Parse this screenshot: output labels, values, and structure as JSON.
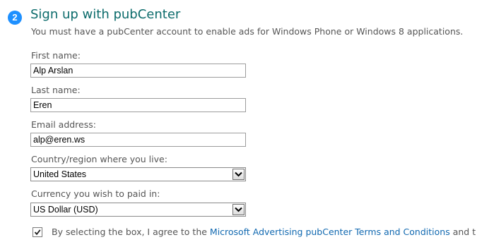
{
  "step": {
    "number": "2",
    "title": "Sign up with pubCenter",
    "subtitle": "You must have a pubCenter account to enable ads for Windows Phone or Windows 8 applications."
  },
  "form": {
    "first_name": {
      "label": "First name:",
      "value": "Alp Arslan"
    },
    "last_name": {
      "label": "Last name:",
      "value": "Eren"
    },
    "email": {
      "label": "Email address:",
      "value": "alp@eren.ws"
    },
    "country": {
      "label": "Country/region where you live:",
      "selected": "United States"
    },
    "currency": {
      "label": "Currency you wish to paid in:",
      "selected": "US Dollar (USD)"
    },
    "agreement": {
      "checked": true,
      "text_before": "By selecting the box, I agree to the ",
      "link_text": "Microsoft Advertising pubCenter Terms and Conditions",
      "text_after": " and t"
    }
  },
  "icons": {
    "dropdown": "chevron-down-icon",
    "checkbox": "checkmark-icon"
  },
  "colors": {
    "badge": "#1e90ff",
    "title": "#0b6b6b",
    "link": "#1068b0"
  }
}
